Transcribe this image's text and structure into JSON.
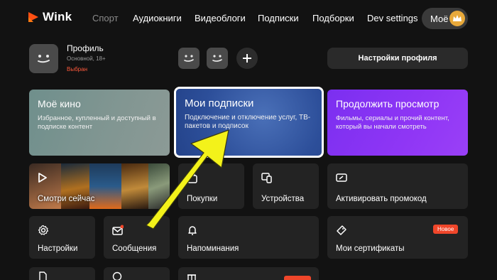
{
  "brand": {
    "name": "Wink",
    "accent": "#ff4f12"
  },
  "nav": {
    "items": [
      "Спорт",
      "Аудиокниги",
      "Видеоблоги",
      "Подписки",
      "Подборки",
      "Dev settings"
    ],
    "moe_label": "Моё",
    "moe_icon": "crown-icon"
  },
  "profile": {
    "name": "Профиль",
    "sub": "Основной, 18+",
    "selected": "Выбран",
    "settings_label": "Настройки профиля"
  },
  "cards": {
    "my_movies": {
      "title": "Моё кино",
      "desc": "Избранное, купленный и доступный в подписке контент"
    },
    "subscriptions": {
      "title": "Мои подписки",
      "desc": "Подключение и отключение услуг, ТВ-пакетов и подписок"
    },
    "continue": {
      "title": "Продолжить просмотр",
      "desc": "Фильмы, сериалы и прочий контент, который вы начали смотреть"
    }
  },
  "tiles": {
    "watch_now": "Смотри сейчас",
    "purchases": "Покупки",
    "devices": "Устройства",
    "promo": "Активировать промокод",
    "settings": "Настройки",
    "messages": "Сообщения",
    "reminders": "Напоминания",
    "certificates": "Мои сертификаты",
    "new_badge": "Новое"
  },
  "colors": {
    "highlight_arrow": "#f3f21a",
    "badge": "#f0462a"
  }
}
